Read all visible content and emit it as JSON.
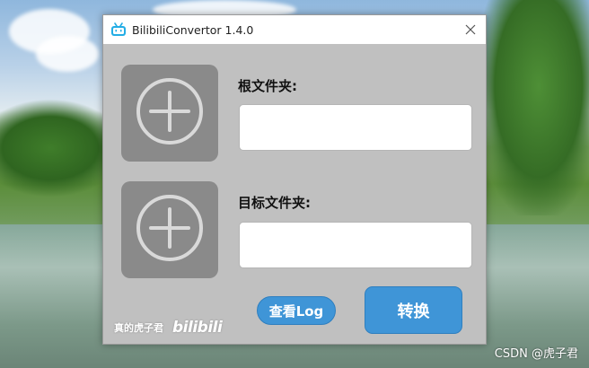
{
  "window": {
    "title": "BilibiliConvertor 1.4.0",
    "app_icon": "bilibili-tv-icon",
    "close_icon": "close-icon"
  },
  "root_folder": {
    "label": "根文件夹:",
    "value": "",
    "add_icon": "plus-circle-icon"
  },
  "target_folder": {
    "label": "目标文件夹:",
    "value": "",
    "add_icon": "plus-circle-icon"
  },
  "buttons": {
    "view_log": "查看Log",
    "convert": "转换"
  },
  "footer": {
    "author": "真的虎子君",
    "brand": "bilibili"
  },
  "desktop": {
    "watermark": "CSDN @虎子君"
  },
  "colors": {
    "window_bg": "#c0c0c0",
    "add_box": "#8a8a8a",
    "button": "#3f95d7",
    "bili_icon": "#23ade5"
  }
}
